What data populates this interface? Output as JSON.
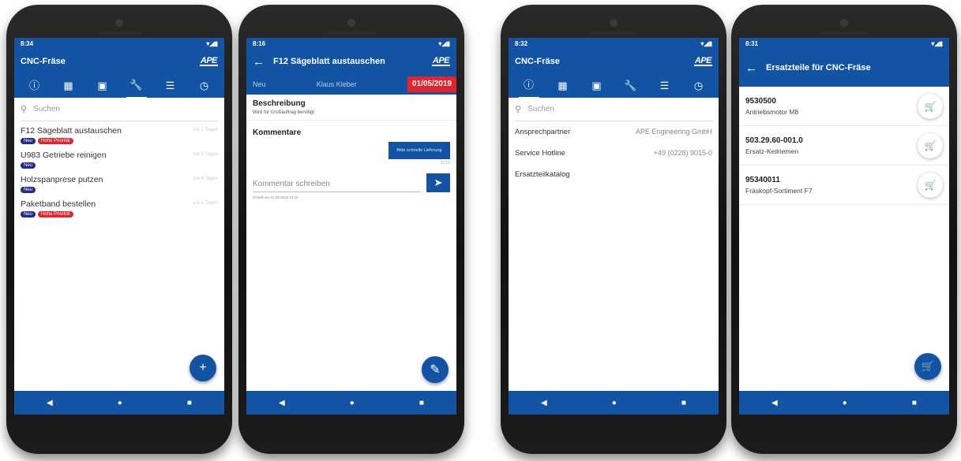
{
  "phone1": {
    "status_time": "8:34",
    "status_icons": "▾◢▮",
    "title": "CNC-Fräse",
    "logo": "APE",
    "search_placeholder": "Suchen",
    "tasks": [
      {
        "title": "F12 Sägeblatt austauschen",
        "time": "vor 2 Tagen",
        "badges": [
          "Neu",
          "Hohe Priorität"
        ]
      },
      {
        "title": "U983 Getriebe reinigen",
        "time": "vor 3 Tagen",
        "badges": [
          "Neu"
        ]
      },
      {
        "title": "Holzspanprese putzen",
        "time": "vor 4 Tagen",
        "badges": [
          "Neu"
        ]
      },
      {
        "title": "Paketband bestellen",
        "time": "vor 5 Tagen",
        "badges": [
          "Neu",
          "Hohe Priorität"
        ]
      }
    ],
    "fab": "+"
  },
  "phone2": {
    "status_time": "8:16",
    "status_icons": "▾◢▮",
    "title": "F12 Sägeblatt austauschen",
    "logo": "APE",
    "status_label": "Neu",
    "assignee": "Klaus Kleber",
    "due_date": "01/05/2019",
    "description_heading": "Beschreibung",
    "description_text": "Wird für Großauftrag benötigt",
    "comments_heading": "Kommentare",
    "comment_bubble": "Bitte schnelle Lieferung",
    "comment_time": "10:15",
    "comment_placeholder": "Kommentar schreiben",
    "meta": "Erstellt am 01.05.2019 10:15",
    "fab": "✎"
  },
  "phone3": {
    "status_time": "8:32",
    "status_icons": "▾◢▮",
    "title": "CNC-Fräse",
    "logo": "APE",
    "search_placeholder": "Suchen",
    "rows": [
      {
        "label": "Ansprechpartner",
        "value": "APE Engineering GmbH"
      },
      {
        "label": "Service Hotline",
        "value": "+49 (0228) 9015-0"
      },
      {
        "label": "Ersatzteilkatalog",
        "value": ""
      }
    ]
  },
  "phone4": {
    "status_time": "8:31",
    "status_icons": "▾◢▮",
    "title": "Ersatzteile für CNC-Fräse",
    "parts": [
      {
        "number": "9530500",
        "name": "Antriebsmotor M8"
      },
      {
        "number": "503.29.60-001.0",
        "name": "Ersatz-Keilriemen"
      },
      {
        "number": "95340011",
        "name": "Fräskopf-Sortiment F7"
      }
    ]
  },
  "icons": {
    "tabs": [
      "info-icon",
      "dashboard-icon",
      "document-icon",
      "wrench-icon",
      "list-icon",
      "history-icon"
    ],
    "nav": [
      "back-nav-icon",
      "home-nav-icon",
      "recents-nav-icon"
    ]
  },
  "colors": {
    "primary": "#1253a4",
    "badge_new": "#1f2a8a",
    "badge_priority": "#e6232b",
    "due_date": "#e6232b"
  }
}
